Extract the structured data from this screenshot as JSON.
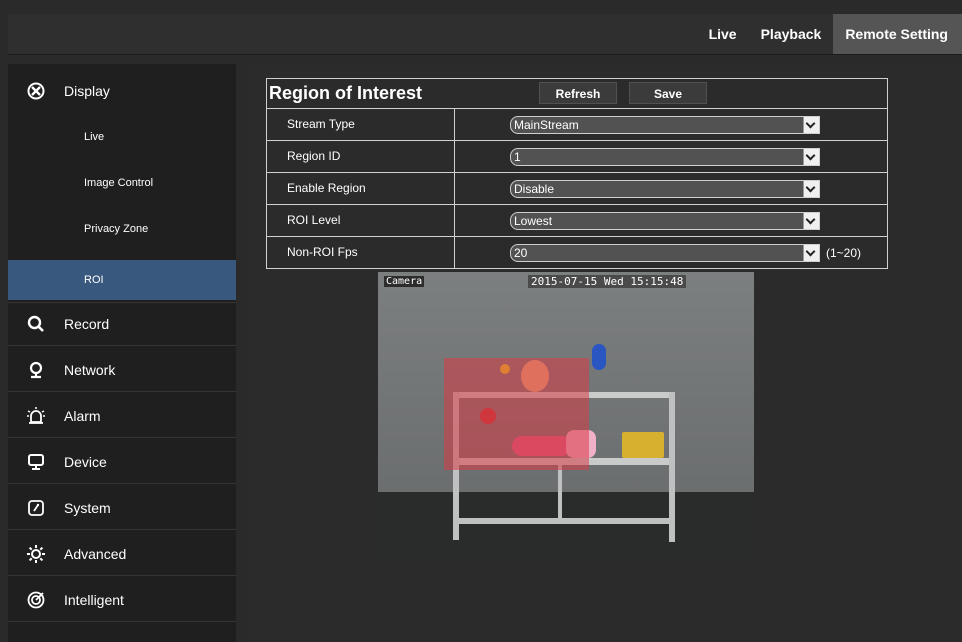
{
  "topnav": {
    "tabs": [
      {
        "label": "Live",
        "active": false
      },
      {
        "label": "Playback",
        "active": false
      },
      {
        "label": "Remote Setting",
        "active": true
      }
    ]
  },
  "sidebar": {
    "items": [
      {
        "label": "Display",
        "icon": "display-icon"
      },
      {
        "label": "Record",
        "icon": "record-icon"
      },
      {
        "label": "Network",
        "icon": "network-icon"
      },
      {
        "label": "Alarm",
        "icon": "alarm-icon"
      },
      {
        "label": "Device",
        "icon": "device-icon"
      },
      {
        "label": "System",
        "icon": "system-icon"
      },
      {
        "label": "Advanced",
        "icon": "advanced-icon"
      },
      {
        "label": "Intelligent",
        "icon": "intelligent-icon"
      }
    ],
    "display_subitems": [
      {
        "label": "Live",
        "active": false
      },
      {
        "label": "Image Control",
        "active": false
      },
      {
        "label": "Privacy Zone",
        "active": false
      },
      {
        "label": "ROI",
        "active": true
      }
    ]
  },
  "roi": {
    "title": "Region of Interest",
    "refresh_label": "Refresh",
    "save_label": "Save",
    "fields": [
      {
        "label": "Stream Type",
        "value": "MainStream"
      },
      {
        "label": "Region ID",
        "value": "1"
      },
      {
        "label": "Enable Region",
        "value": "Disable"
      },
      {
        "label": "ROI Level",
        "value": "Lowest"
      },
      {
        "label": "Non-ROI Fps",
        "value": "20",
        "range": "(1~20)"
      }
    ]
  },
  "camera": {
    "label": "Camera",
    "timestamp": "2015-07-15 Wed 15:15:48"
  },
  "colors": {
    "accent": "#39587d",
    "active_tab": "#555555",
    "roi_region": "#d73c46"
  }
}
